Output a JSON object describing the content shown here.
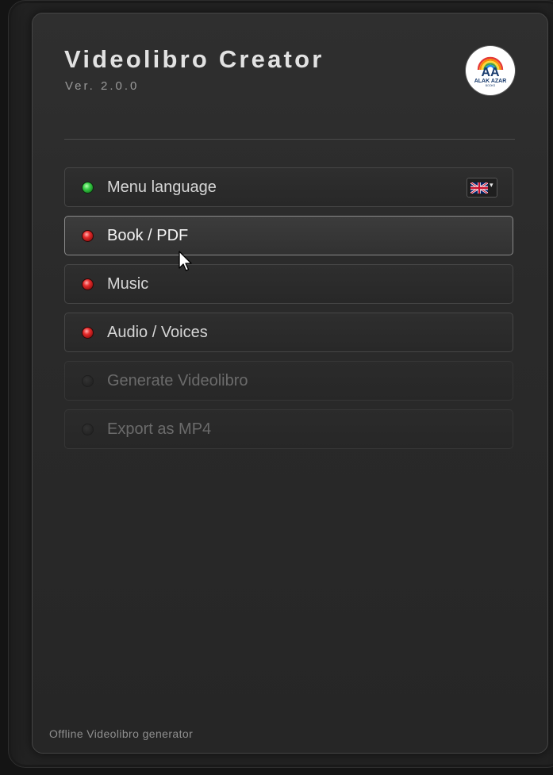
{
  "app": {
    "title": "Videolibro Creator",
    "version": "Ver. 2.0.0",
    "logo": {
      "line1": "AA",
      "line2": "ALAK AZAR",
      "line3": "BOOKS"
    }
  },
  "menu": {
    "items": [
      {
        "label": "Menu language",
        "status": "green",
        "state": "normal"
      },
      {
        "label": "Book / PDF",
        "status": "red",
        "state": "active"
      },
      {
        "label": "Music",
        "status": "red",
        "state": "normal"
      },
      {
        "label": "Audio / Voices",
        "status": "red",
        "state": "normal"
      },
      {
        "label": "Generate Videolibro",
        "status": "off",
        "state": "disabled"
      },
      {
        "label": "Export as MP4",
        "status": "off",
        "state": "disabled"
      }
    ],
    "language_select": {
      "selected_icon": "uk-flag-icon",
      "dropdown_icon": "chevron-down-icon",
      "arrow": "▾"
    }
  },
  "footer": {
    "text": "Offline Videolibro generator"
  },
  "colors": {
    "led_green": "#3ad04a",
    "led_red": "#e62b2b",
    "panel_bg": "#2a2a2a",
    "text": "#d6d6d6",
    "text_disabled": "#6b6b6b"
  }
}
